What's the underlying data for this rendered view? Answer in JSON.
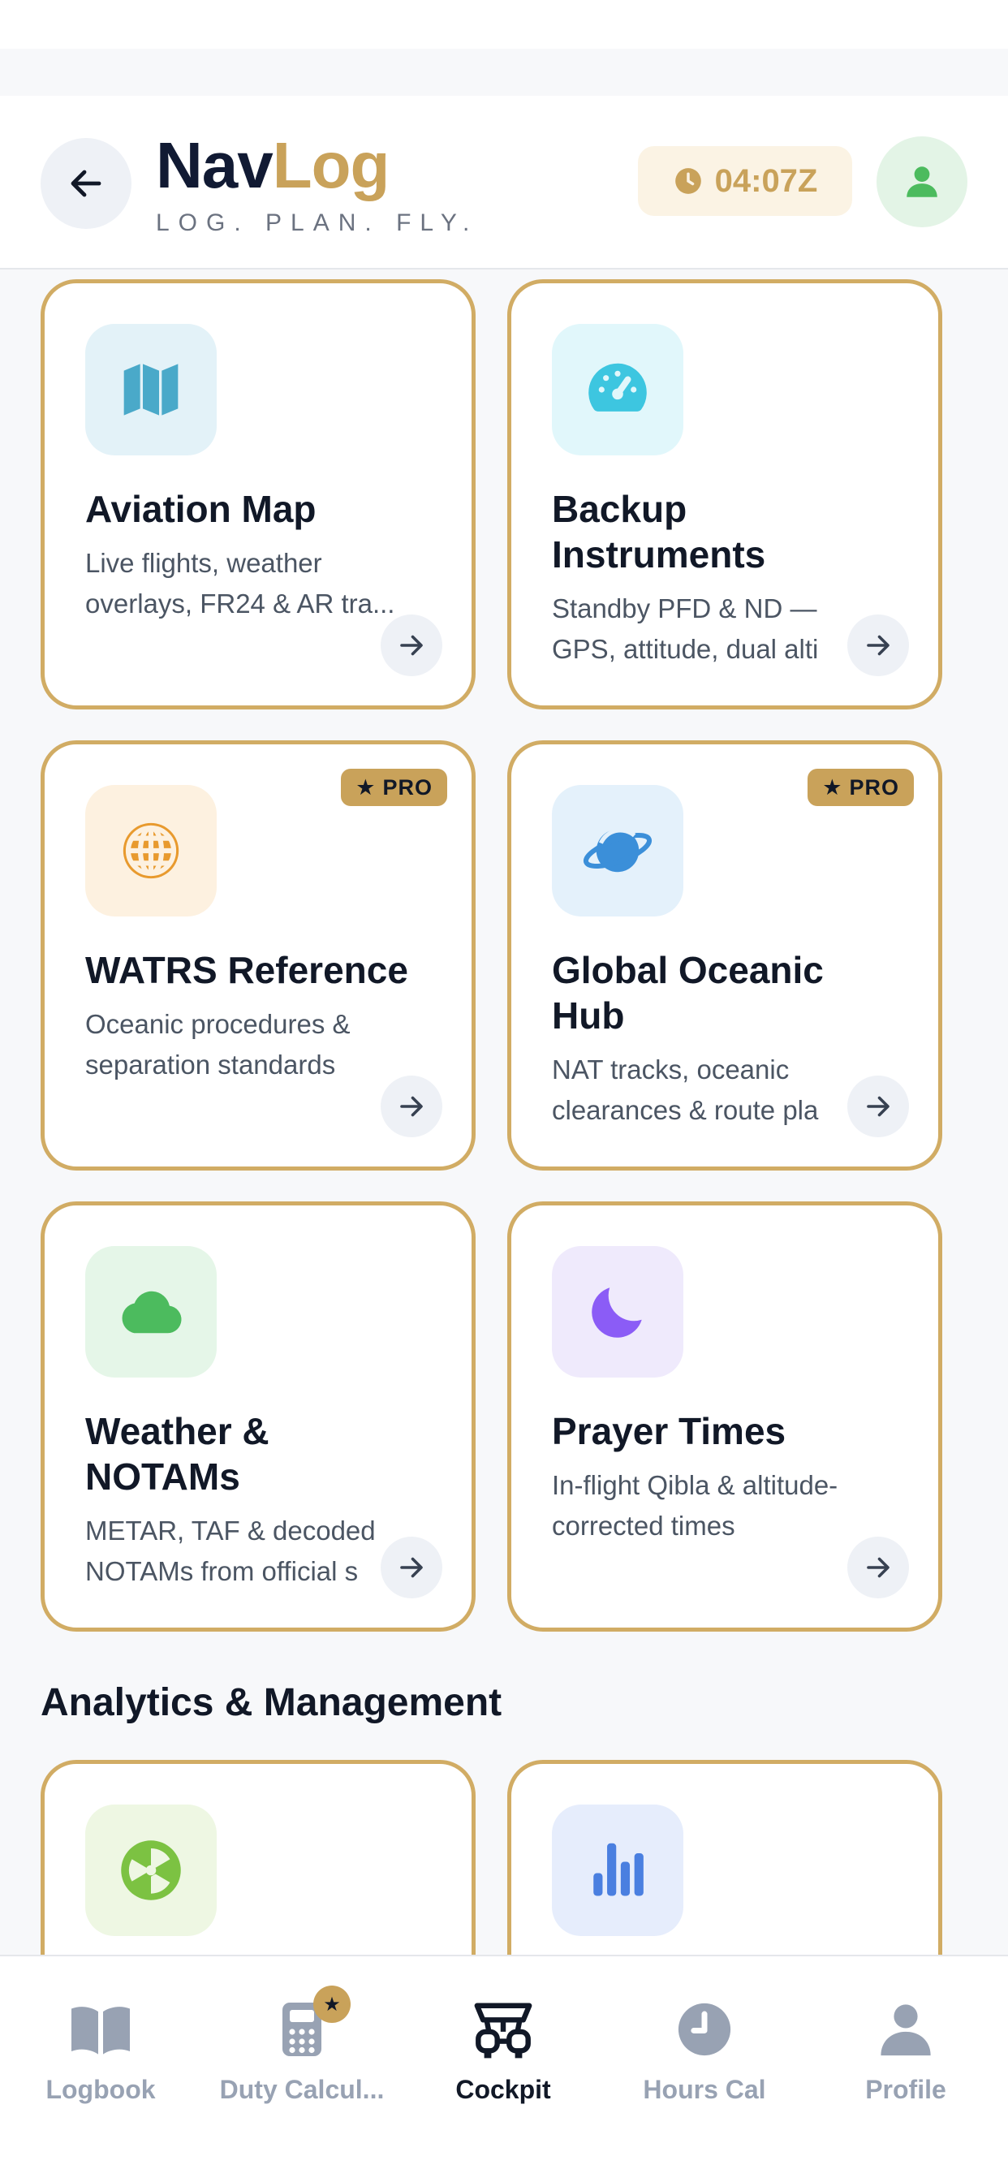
{
  "header": {
    "brand_part1": "Nav",
    "brand_part2": "Log",
    "tagline": "LOG. PLAN. FLY.",
    "utc_time": "04:07Z"
  },
  "cards": [
    {
      "title": "Aviation Map",
      "desc": "Live flights, weather\noverlays, FR24 & AR tra...",
      "icon": "map-icon",
      "pro": false
    },
    {
      "title": "Backup\nInstruments",
      "desc": "Standby PFD & ND —\nGPS, attitude, dual alti",
      "icon": "gauge-icon",
      "pro": false
    },
    {
      "title": "WATRS Reference",
      "desc": "Oceanic procedures &\nseparation standards",
      "icon": "globe-icon",
      "pro": true
    },
    {
      "title": "Global Oceanic\nHub",
      "desc": "NAT tracks, oceanic\nclearances & route pla",
      "icon": "planet-icon",
      "pro": true
    },
    {
      "title": "Weather &\nNOTAMs",
      "desc": "METAR, TAF & decoded\nNOTAMs from official s",
      "icon": "cloud-icon",
      "pro": false
    },
    {
      "title": "Prayer Times",
      "desc": "In-flight Qibla & altitude-\ncorrected times",
      "icon": "moon-icon",
      "pro": false
    }
  ],
  "pro_badge_label": "PRO",
  "section": {
    "title": "Analytics & Management"
  },
  "analytics_cards": [
    {
      "icon": "radiation-icon"
    },
    {
      "icon": "bar-chart-icon"
    }
  ],
  "nav": {
    "items": [
      {
        "label": "Logbook",
        "icon": "book-icon"
      },
      {
        "label": "Duty Calcul...",
        "icon": "calculator-icon",
        "badge": "★"
      },
      {
        "label": "Cockpit",
        "icon": "cockpit-icon",
        "active": true
      },
      {
        "label": "Hours Cal",
        "icon": "clock-icon"
      },
      {
        "label": "Profile",
        "icon": "person-icon"
      }
    ]
  },
  "colors": {
    "gold": "#c9a25a",
    "navy": "#111a33",
    "card_border": "#d1ac64",
    "inactive_nav": "#98a2b3"
  }
}
